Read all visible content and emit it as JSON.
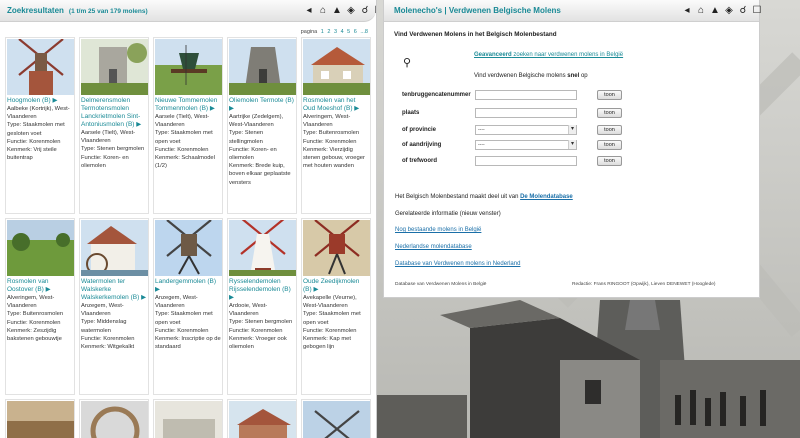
{
  "left_panel": {
    "title": "Zoekresultaten",
    "count": "(1 t/m 25 van 179 molens)",
    "pager_label": "pagina",
    "pages": [
      "1",
      "2",
      "3",
      "4",
      "5",
      "6",
      "...8"
    ],
    "tools": [
      "back-arrow-icon",
      "home-icon",
      "tree-icon",
      "map-icon",
      "search-icon",
      "book-icon"
    ]
  },
  "results": [
    {
      "name": "Hoogmolen (B)",
      "lines": [
        "Aalbeke (Kortrijk), West-Vlaanderen",
        "Type: Staakmolen met gesloten voet",
        "Functie: Korenmolen",
        "Kenmerk: Vrij steile buitentrap"
      ],
      "img": "windmill-post-brick"
    },
    {
      "name": "Delmerensmolen Termotensmolen Lanckrietmolen Sint-Antoniusmolen (B)",
      "lines": [
        "Aarsele (Tielt), West-Vlaanderen",
        "Type: Stenen bergmolen",
        "Functie: Koren- en oliemolen"
      ],
      "img": "ruin-grey"
    },
    {
      "name": "Nieuwe Tommemolen Tommenmolen (B)",
      "lines": [
        "Aarsele (Tielt), West-Vlaanderen",
        "Type: Staakmolen met open voet",
        "Functie: Korenmolen",
        "Kenmerk: Schaalmodel (1/2)"
      ],
      "img": "small-post-green"
    },
    {
      "name": "Oliemolen Termote (B)",
      "lines": [
        "Aartrijke (Zedelgem), West-Vlaanderen",
        "Type: Stenen stellingmolen",
        "Functie: Koren- en oliemolen",
        "Kenmerk: Brede kuip, boven elkaar geplaatste vensters"
      ],
      "img": "tower-stump"
    },
    {
      "name": "Rosmolen van het Oud Moeshof (B)",
      "lines": [
        "Alveringem, West-Vlaanderen",
        "Type: Buitenrosmolen",
        "Functie: Korenmolen",
        "Kenmerk: Vierzijdig stenen gebouw, vroeger met houten wanden"
      ],
      "img": "farmhouse"
    },
    {
      "name": "Rosmolen van Oostover (B)",
      "lines": [
        "Alveringem, West-Vlaanderen",
        "Type: Buitenrosmolen",
        "Functie: Korenmolen",
        "Kenmerk: Zeszijdig bakstenen gebouwtje"
      ],
      "img": "green-field"
    },
    {
      "name": "Watermolen ter Walskerke Walskerkemolen (B)",
      "lines": [
        "Anzegem, West-Vlaanderen",
        "Type: Middenslag watermolen",
        "Functie: Korenmolen",
        "Kenmerk: Witgekalkt"
      ],
      "img": "white-watermill"
    },
    {
      "name": "Landergemmolen (B)",
      "lines": [
        "Anzegem, West-Vlaanderen",
        "Type: Staakmolen met open voet",
        "Functie: Korenmolen",
        "Kenmerk: Inscriptie op de standaard"
      ],
      "img": "post-mill-sky"
    },
    {
      "name": "Rysselendemolen Rijsselendemolen (B)",
      "lines": [
        "Ardooie, West-Vlaanderen",
        "Type: Stenen bergmolen",
        "Functie: Korenmolen",
        "Kenmerk: Vroeger ook oliemolen"
      ],
      "img": "white-tower-red"
    },
    {
      "name": "Oude Zeedijkmolen (B)",
      "lines": [
        "Avekapelle (Veurne), West-Vlaanderen",
        "Type: Staakmolen met open voet",
        "Functie: Korenmolen",
        "Kenmerk: Kap met gebogen lijn"
      ],
      "img": "post-mill-red"
    },
    {
      "name": "",
      "lines": [],
      "img": "bottom-1"
    },
    {
      "name": "",
      "lines": [],
      "img": "bottom-2"
    },
    {
      "name": "",
      "lines": [],
      "img": "bottom-3"
    },
    {
      "name": "",
      "lines": [],
      "img": "bottom-4"
    },
    {
      "name": "",
      "lines": [],
      "img": "bottom-5"
    }
  ],
  "right_panel": {
    "title": "Molenecho's | Verdwenen Belgische Molens",
    "heading": "Vind Verdwenen Molens in het Belgisch Molenbestand",
    "advanced_link": "Geavanceerd",
    "advanced_rest": " zoeken naar verdwenen molens in België",
    "quick_pre": "Vind verdwenen Belgische molens ",
    "quick_bold": "snel",
    "quick_post": " op",
    "fields": [
      {
        "label": "tenbruggencatenummer",
        "kind": "input",
        "value": ""
      },
      {
        "label": "plaats",
        "kind": "input",
        "value": ""
      },
      {
        "label": "of provincie",
        "kind": "select",
        "value": "----"
      },
      {
        "label": "of aandrijving",
        "kind": "select",
        "value": "----"
      },
      {
        "label": "of trefwoord",
        "kind": "input",
        "value": ""
      }
    ],
    "button_label": "toon",
    "info_pre": "Het Belgisch Molenbestand maakt deel uit van ",
    "info_link": "De Molendatabase",
    "related": "Gerelateerde informatie (nieuw venster)",
    "links": [
      "Nog bestaande molens in België",
      "Nederlandse molendatabase",
      "Database van Verdwenen molens in Nederland"
    ],
    "footer_left": "Database van Verdwenen Molens in België",
    "footer_right": "Redactie: Frans RINGOOT (Opwijk), Lieven DENEWET (Hooglede)"
  }
}
